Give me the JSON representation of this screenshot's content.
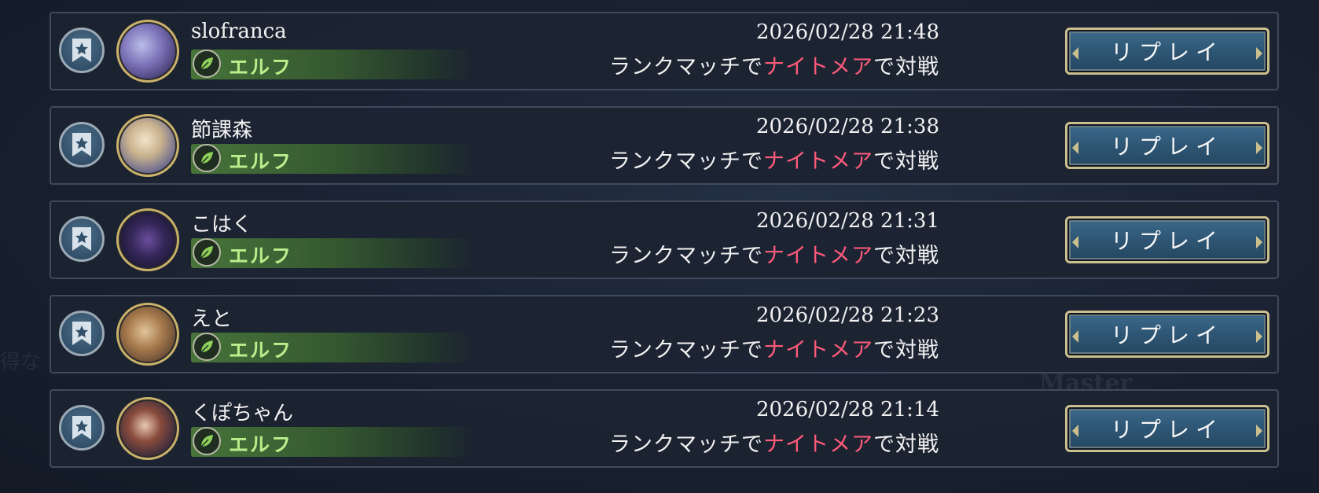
{
  "background_text": {
    "left": "得な",
    "right": "Master"
  },
  "colors": {
    "accent_highlight": "#ff5a7a",
    "class_label": "#b9ee8c",
    "button_blue": "#2e5674",
    "button_border": "#cbbf8e"
  },
  "replays": [
    {
      "player": "slofranca",
      "class_name": "エルフ",
      "datetime": "2026/02/28 21:48",
      "desc_prefix": "ランクマッチで",
      "opponent_class": "ナイトメア",
      "desc_suffix": "で対戦",
      "button": "リプレイ"
    },
    {
      "player": "節課森",
      "class_name": "エルフ",
      "datetime": "2026/02/28 21:38",
      "desc_prefix": "ランクマッチで",
      "opponent_class": "ナイトメア",
      "desc_suffix": "で対戦",
      "button": "リプレイ"
    },
    {
      "player": "こはく",
      "class_name": "エルフ",
      "datetime": "2026/02/28 21:31",
      "desc_prefix": "ランクマッチで",
      "opponent_class": "ナイトメア",
      "desc_suffix": "で対戦",
      "button": "リプレイ"
    },
    {
      "player": "えと",
      "class_name": "エルフ",
      "datetime": "2026/02/28 21:23",
      "desc_prefix": "ランクマッチで",
      "opponent_class": "ナイトメア",
      "desc_suffix": "で対戦",
      "button": "リプレイ"
    },
    {
      "player": "くぽちゃん",
      "class_name": "エルフ",
      "datetime": "2026/02/28 21:14",
      "desc_prefix": "ランクマッチで",
      "opponent_class": "ナイトメア",
      "desc_suffix": "で対戦",
      "button": "リプレイ"
    }
  ]
}
